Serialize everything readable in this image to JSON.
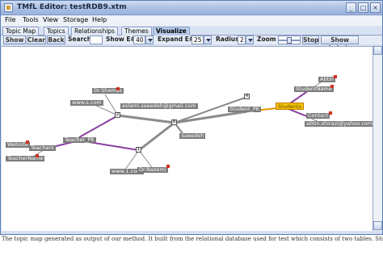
{
  "window": {
    "title": "TMfL Editor: testRDB9.xtm",
    "controls": {
      "minimize": "_",
      "maximize": "□",
      "close": "×"
    }
  },
  "menu": [
    "File",
    "Tools",
    "View",
    "Storage",
    "Help"
  ],
  "tabs": [
    {
      "label": "Topic Map",
      "active": false
    },
    {
      "label": "Topics",
      "active": false
    },
    {
      "label": "Relationships",
      "active": false
    },
    {
      "label": "Themes",
      "active": false
    },
    {
      "label": "Visualize",
      "active": true
    }
  ],
  "toolbar": {
    "show_label": "Show",
    "clear_label": "Clear",
    "back_label": "Back",
    "search_label": "Search",
    "search_value": "",
    "show_e_label": "Show E#",
    "show_e_value": "40",
    "expand_e_label": "Expand E#",
    "expand_e_value": "25",
    "radius_label": "Radius",
    "radius_value": "2",
    "zoom_label": "Zoom",
    "stop_label": "Stop",
    "show_labels_label": "Show Labels"
  },
  "graph": {
    "nodes": [
      {
        "id": "shamas",
        "label": "Dr.Shamas"
      },
      {
        "id": "wwws",
        "label": "www.s.com"
      },
      {
        "id": "eslami",
        "label": "eslami.saeedeh@gmail.com"
      },
      {
        "id": "studentpk",
        "label": "Student_PK"
      },
      {
        "id": "abtin",
        "label": "Abtin"
      },
      {
        "id": "studentname",
        "label": "StudentName"
      },
      {
        "id": "students",
        "label": "Students",
        "highlighted": true
      },
      {
        "id": "contact",
        "label": "Contact"
      },
      {
        "id": "abtinmail",
        "label": "abtin.shirazi@yahoo.com"
      },
      {
        "id": "saeedeh",
        "label": "Saeedeh"
      },
      {
        "id": "website",
        "label": "Website"
      },
      {
        "id": "teachers",
        "label": "Teachers"
      },
      {
        "id": "teacherpk",
        "label": "Teacher_PK"
      },
      {
        "id": "teachername",
        "label": "TeacherName"
      },
      {
        "id": "www1",
        "label": "www.1.com"
      },
      {
        "id": "nazemi",
        "label": "Dr.Nazemi"
      }
    ],
    "hubs": [
      {
        "id": "hub-2",
        "label": "2"
      },
      {
        "id": "hub-8",
        "label": "8"
      },
      {
        "id": "hub-4",
        "label": "4"
      },
      {
        "id": "hub-1",
        "label": "1"
      }
    ],
    "colors": {
      "edge_gray": "#8a8a8a",
      "edge_purple": "#8a3fa0",
      "edge_orange": "#e09a00",
      "label_bg": "#7c7c7c",
      "highlight": "#f4c400"
    }
  },
  "caption": "The topic map generated as output of our method. It built from the relational database used for test which consists of two tables. Stude"
}
